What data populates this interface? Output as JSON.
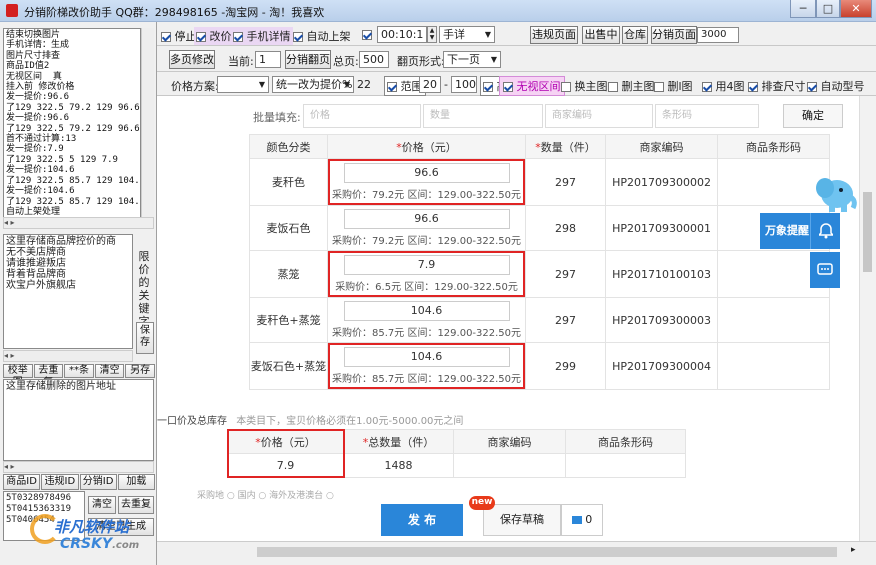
{
  "window": {
    "title": "分销阶梯改价助手 QQ群：298498165 -淘宝网 - 淘！我喜欢",
    "min": "─",
    "max": "□",
    "close": "✕"
  },
  "left": {
    "log_lines": [
      "结束切换图片",
      "手机详情：生成",
      "图片尺寸排查",
      "商品ID值2",
      "无视区间  真",
      "挂入前 修改价格",
      "发一提价:96.6",
      "了129 322.5 79.2 129 96.6",
      "发一提价:96.6",
      "了129 322.5 79.2 129 96.6",
      "首不通过计算:13",
      "发一提价:7.9",
      "了129 322.5 5 129 7.9",
      "发一提价:104.6",
      "了129 322.5 85.7 129 104.6",
      "发一提价:104.6",
      "了129 322.5 85.7 129 104.6",
      "自动上架处理"
    ],
    "brand_lines": [
      "这里存储商品牌控价的商",
      "无不美店牌商",
      "请谁推避叛店",
      "背着背品牌商",
      "欢宝户外旗舰店"
    ],
    "side_label": "限价的关键字",
    "save_label": "保存",
    "tabs1": [
      "校举图",
      "去重复",
      "**条",
      "清空",
      "另存"
    ],
    "url_note": "这里存储删除的图片地址",
    "tabs2": [
      "商品ID",
      "违规ID",
      "分销ID",
      "加载"
    ],
    "ids": [
      "5T0328978496",
      "5T0415363319",
      "5T0406454"
    ],
    "clear_label": "清空",
    "dedup_label": "去重复",
    "gen_label": "清空已生成"
  },
  "toolbar1": {
    "stop": "停止",
    "reprice": "改价",
    "mobile": "手机详情",
    "autolist": "自动上架",
    "time": "00:10:1",
    "mode": "手详",
    "violation_btn": "违规页面",
    "sold_btn": "出售中",
    "warehouse_btn": "仓库",
    "dist_btn": "分销页面",
    "page_val": "3000"
  },
  "toolbar2": {
    "multi_btn": "多页修改",
    "current_label": "当前:",
    "current_val": "1",
    "dist_page_btn": "分销翻页",
    "total_label": "总页:",
    "total_val": "500",
    "flip_label": "翻页形式:",
    "flip_val": "下一页"
  },
  "toolbar3": {
    "scheme_label": "价格方案:",
    "scheme_val": "",
    "unify_label": "统一改为提价%",
    "pct": "22",
    "range_label": "范围",
    "range_min": "20",
    "range_sep": "-",
    "range_max": "100",
    "high": "高",
    "ignore": "无视区间",
    "replace_main": "换主图",
    "del_main": "删主图",
    "del_img": "删l图",
    "use4": "用4图",
    "check_size": "排查尺寸",
    "auto_model": "自动型号"
  },
  "batch": {
    "label": "批量填充:",
    "price_ph": "价格",
    "qty_ph": "数量",
    "code_ph": "商家编码",
    "barcode_ph": "条形码",
    "confirm": "确定"
  },
  "sku_table": {
    "headers": [
      "颜色分类",
      "*价格（元）",
      "*数量（件）",
      "商家编码",
      "商品条形码"
    ],
    "rows": [
      {
        "color": "麦秆色",
        "price": "96.6",
        "info": "采购价：79.2元 区间：129.00-322.50元",
        "qty": "297",
        "code": "HP201709300002"
      },
      {
        "color": "麦饭石色",
        "price": "96.6",
        "info": "采购价：79.2元 区间：129.00-322.50元",
        "qty": "298",
        "code": "HP201709300001"
      },
      {
        "color": "蒸笼",
        "price": "7.9",
        "info": "采购价：6.5元 区间：129.00-322.50元",
        "qty": "297",
        "code": "HP201710100103"
      },
      {
        "color": "麦秆色+蒸笼",
        "price": "104.6",
        "info": "采购价：85.7元 区间：129.00-322.50元",
        "qty": "297",
        "code": "HP201709300003"
      },
      {
        "color": "麦饭石色+蒸笼",
        "price": "104.6",
        "info": "采购价：85.7元 区间：129.00-322.50元",
        "qty": "299",
        "code": "HP201709300004"
      }
    ]
  },
  "ad": {
    "remind": "万象提醒"
  },
  "summary": {
    "label": "一口价及总库存",
    "note": "本类目下，宝贝价格必须在1.00元-5000.00元之间",
    "headers": [
      "*价格（元）",
      "*总数量（件）",
      "商家编码",
      "商品条形码"
    ],
    "price": "7.9",
    "total_qty": "1488"
  },
  "cut_row": "采购地 ○ 国内 ○ 海外及港澳台 ○",
  "actions": {
    "publish": "发 布",
    "save_draft": "保存草稿",
    "new_badge": "new",
    "count": "0"
  },
  "watermark": {
    "cn": "非凡软件站",
    "en": "CRSKY",
    "dotcom": ".com"
  }
}
